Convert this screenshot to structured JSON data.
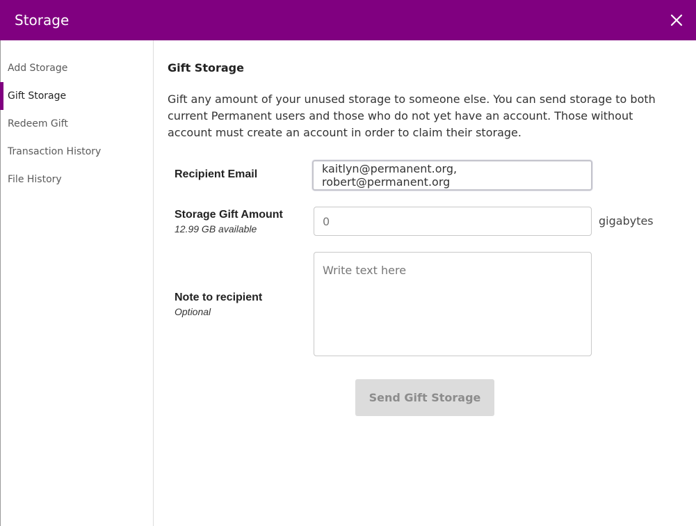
{
  "header": {
    "title": "Storage",
    "close_icon": "close-icon"
  },
  "sidebar": {
    "items": [
      {
        "label": "Add Storage",
        "active": false
      },
      {
        "label": "Gift Storage",
        "active": true
      },
      {
        "label": "Redeem Gift",
        "active": false
      },
      {
        "label": "Transaction History",
        "active": false
      },
      {
        "label": "File History",
        "active": false
      }
    ]
  },
  "main": {
    "title": "Gift Storage",
    "description": "Gift any amount of your unused storage to someone else. You can send storage to both current Permanent users and those who do not yet have an account. Those without account must create an account in order to claim their storage.",
    "recipient": {
      "label": "Recipient Email",
      "value": "kaitlyn@permanent.org, robert@permanent.org"
    },
    "amount": {
      "label": "Storage Gift Amount",
      "available": "12.99 GB available",
      "placeholder": "0",
      "unit": "gigabytes"
    },
    "note": {
      "label": "Note to recipient",
      "sublabel": "Optional",
      "placeholder": "Write text here"
    },
    "send_button": "Send Gift Storage"
  },
  "colors": {
    "brand": "#800080",
    "button_disabled": "#dcdcdc"
  }
}
